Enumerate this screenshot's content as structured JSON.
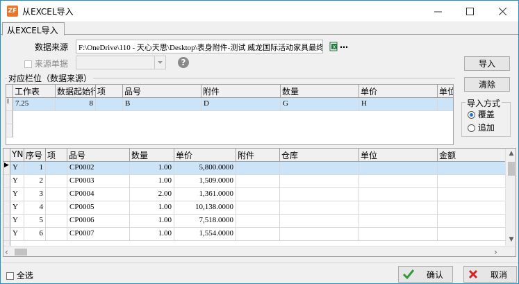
{
  "window": {
    "title": "从EXCEL导入",
    "app_icon": "ZF"
  },
  "tab": {
    "label": "从EXCEL导入"
  },
  "source": {
    "label": "数据来源",
    "path": "F:\\OneDrive\\110 - 天心天思\\Desktop\\表身附件-测试 威龙国际活动家具最终",
    "browse": "…"
  },
  "source_doc": {
    "label": "来源单据"
  },
  "mapping": {
    "label": "对应栏位（数据来源）",
    "columns": [
      "工作表",
      "数据起始行",
      "项",
      "品号",
      "附件",
      "数量",
      "单价",
      "单位"
    ],
    "row": {
      "indicator": "I",
      "sheet": "7.25",
      "start_row": "8",
      "item": "",
      "part_no": "B",
      "attachment": "D",
      "qty": "G",
      "price": "H",
      "unit": ""
    }
  },
  "buttons": {
    "import": "导入",
    "clear": "清除",
    "ok": "确认",
    "cancel": "取消"
  },
  "import_mode": {
    "label": "导入方式",
    "options": [
      "覆盖",
      "追加"
    ],
    "selected": "覆盖"
  },
  "data": {
    "columns": [
      "YN",
      "序号",
      "项",
      "品号",
      "数量",
      "单价",
      "附件",
      "仓库",
      "单位",
      "金额"
    ],
    "rows": [
      {
        "yn": "Y",
        "seq": "1",
        "item": "",
        "part_no": "CP0002",
        "qty": "1.00",
        "price": "5,800.0000"
      },
      {
        "yn": "Y",
        "seq": "2",
        "item": "",
        "part_no": "CP0003",
        "qty": "1.00",
        "price": "1,509.0000"
      },
      {
        "yn": "Y",
        "seq": "3",
        "item": "",
        "part_no": "CP0004",
        "qty": "2.00",
        "price": "1,361.0000"
      },
      {
        "yn": "Y",
        "seq": "4",
        "item": "",
        "part_no": "CP0005",
        "qty": "1.00",
        "price": "10,138.0000"
      },
      {
        "yn": "Y",
        "seq": "5",
        "item": "",
        "part_no": "CP0006",
        "qty": "1.00",
        "price": "7,518.0000"
      },
      {
        "yn": "Y",
        "seq": "6",
        "item": "",
        "part_no": "CP0007",
        "qty": "1.00",
        "price": "1,554.0000"
      }
    ]
  },
  "select_all": {
    "label": "全选"
  },
  "colors": {
    "selected_row": "#cce4f7",
    "ok_check": "#2e9b3a",
    "cancel_x": "#d62020",
    "window_border": "#1e90c8",
    "help": "#8a8a8a"
  }
}
